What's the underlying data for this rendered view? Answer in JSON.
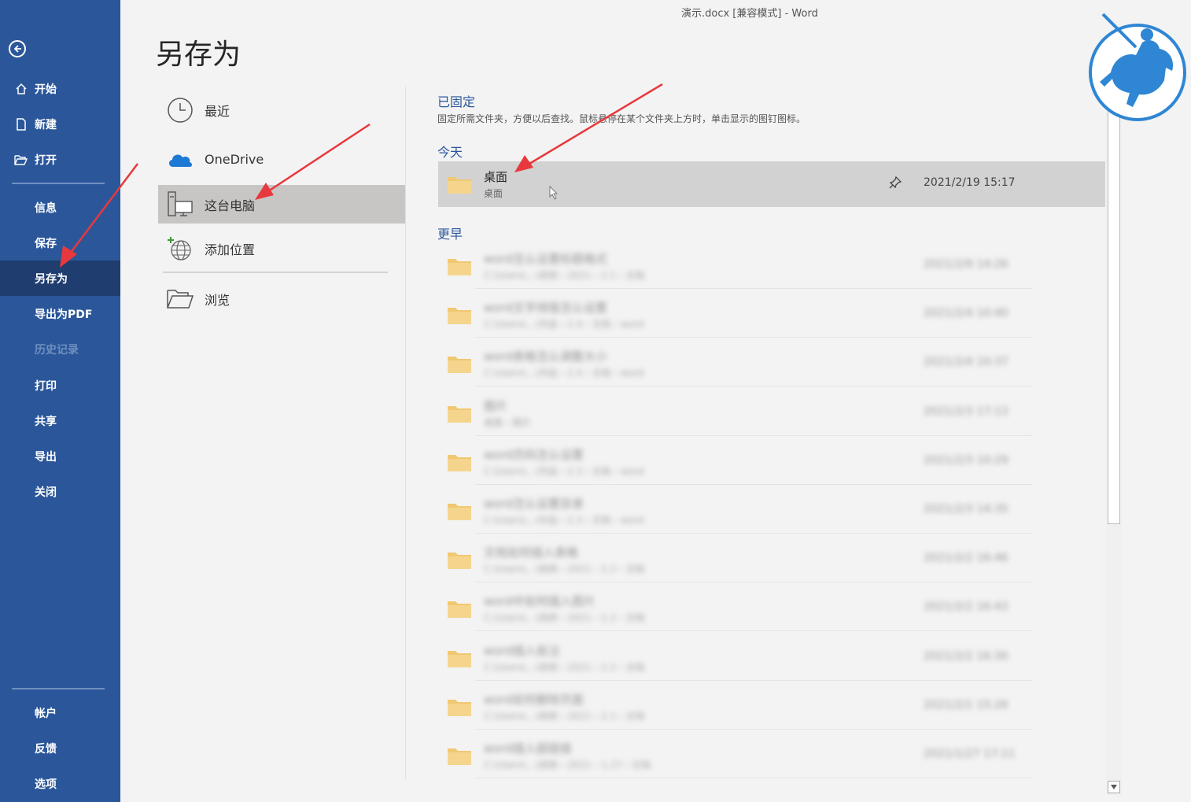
{
  "window": {
    "title": "演示.docx [兼容模式]  -  Word"
  },
  "sidebar": {
    "items": [
      {
        "label": "开始",
        "icon": "home-icon"
      },
      {
        "label": "新建",
        "icon": "new-doc-icon"
      },
      {
        "label": "打开",
        "icon": "open-folder-icon"
      },
      {
        "label": "信息"
      },
      {
        "label": "保存"
      },
      {
        "label": "另存为",
        "active": true
      },
      {
        "label": "导出为PDF"
      },
      {
        "label": "历史记录",
        "disabled": true
      },
      {
        "label": "打印"
      },
      {
        "label": "共享"
      },
      {
        "label": "导出"
      },
      {
        "label": "关闭"
      },
      {
        "label": "帐户"
      },
      {
        "label": "反馈"
      },
      {
        "label": "选项"
      }
    ]
  },
  "page": {
    "title": "另存为"
  },
  "locations": [
    {
      "label": "最近",
      "icon": "clock-icon"
    },
    {
      "label": "OneDrive",
      "icon": "cloud-icon"
    },
    {
      "label": "这台电脑",
      "icon": "pc-icon",
      "active": true
    },
    {
      "label": "添加位置",
      "icon": "globe-add-icon"
    },
    {
      "label": "浏览",
      "icon": "folder-open-icon"
    }
  ],
  "pinned": {
    "heading": "已固定",
    "description": "固定所需文件夹，方便以后查找。鼠标悬停在某个文件夹上方时，单击显示的图钉图标。"
  },
  "today": {
    "heading": "今天",
    "folder": {
      "name": "桌面",
      "path": "桌面",
      "date": "2021/2/19 15:17"
    }
  },
  "earlier": {
    "heading": "更早",
    "folders": [
      {
        "name": "word怎么设置标题格式",
        "path": "C:\\Users\\...\\视频 › 2021 › 2.1 › 文档",
        "date": "2021/2/9 14:26"
      },
      {
        "name": "word文字排版怎么设置",
        "path": "C:\\Users\\...\\作品 › 2.4 › 文档 › word",
        "date": "2021/2/4 10:40"
      },
      {
        "name": "word表格怎么调整大小",
        "path": "C:\\Users\\...\\作品 › 2.4 › 文档 › word",
        "date": "2021/2/4 10:37"
      },
      {
        "name": "图片",
        "path": "桌面 › 图片",
        "date": "2021/2/3 17:13"
      },
      {
        "name": "word页码怎么设置",
        "path": "C:\\Users\\...\\作品 › 2.3 › 文档 › word",
        "date": "2021/2/3 10:29"
      },
      {
        "name": "word怎么设置目录",
        "path": "C:\\Users\\...\\作品 › 2.3 › 文档 › word",
        "date": "2021/2/3 14:35"
      },
      {
        "name": "文档如何插入表格",
        "path": "C:\\Users\\...\\视频 › 2021 › 2.2 › 文档",
        "date": "2021/2/2 16:46"
      },
      {
        "name": "word中如何插入图片",
        "path": "C:\\Users\\...\\视频 › 2021 › 2.2 › 文档",
        "date": "2021/2/2 16:43"
      },
      {
        "name": "word插入批注",
        "path": "C:\\Users\\...\\视频 › 2021 › 2.2 › 文档",
        "date": "2021/2/2 16:30"
      },
      {
        "name": "word如何删除页面",
        "path": "C:\\Users\\...\\视频 › 2021 › 2.1 › 文档",
        "date": "2021/2/1 15:26"
      },
      {
        "name": "word插入超链接",
        "path": "C:\\Users\\...\\视频 › 2021 › 1.27 › 文档",
        "date": "2021/1/27 17:11"
      }
    ]
  },
  "colors": {
    "sidebar": "#2b579a",
    "sidebar_active": "#1f3d6e",
    "accent": "#2b579a",
    "folder": "#f0c872",
    "arrow": "#e8383d"
  }
}
